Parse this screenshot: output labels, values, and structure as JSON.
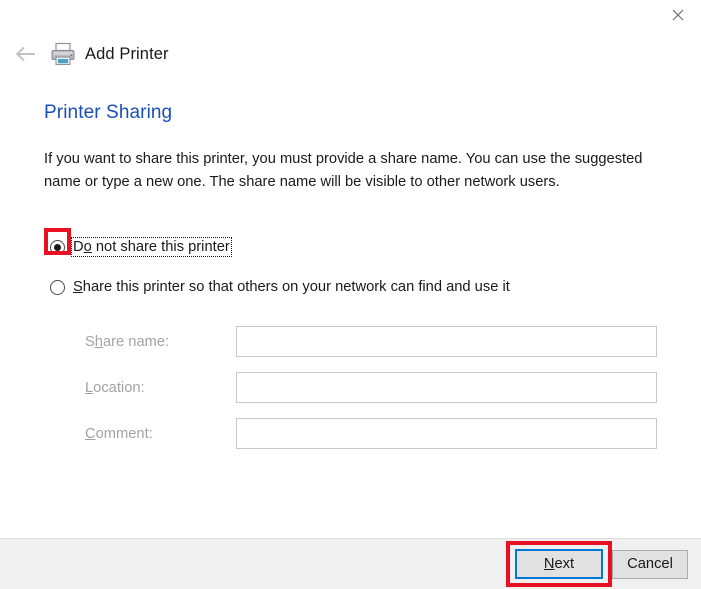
{
  "window": {
    "close_label": "Close",
    "close_icon": "close-icon"
  },
  "nav": {
    "back_icon": "back-arrow-icon",
    "printer_icon": "printer-icon",
    "title": "Add Printer"
  },
  "page": {
    "heading": "Printer Sharing",
    "intro": "If you want to share this printer, you must provide a share name. You can use the suggested name or type a new one. The share name will be visible to other network users."
  },
  "radios": [
    {
      "id": "do-not-share",
      "label_prefix": "D",
      "label_accel": "o",
      "label_suffix": " not share this printer",
      "full_label": "Do not share this printer",
      "checked": true,
      "focused": true,
      "highlighted": true
    },
    {
      "id": "share-printer",
      "label_prefix": "",
      "label_accel": "S",
      "label_suffix": "hare this printer so that others on your network can find and use it",
      "full_label": "Share this printer so that others on your network can find and use it",
      "checked": false,
      "focused": false,
      "highlighted": false
    }
  ],
  "form": {
    "fields": [
      {
        "id": "share-name",
        "label_prefix": "S",
        "label_accel": "h",
        "label_suffix": "are name:",
        "full_label": "Share name:",
        "value": "",
        "placeholder": "",
        "disabled": true
      },
      {
        "id": "location",
        "label_prefix": "",
        "label_accel": "L",
        "label_suffix": "ocation:",
        "full_label": "Location:",
        "value": "",
        "placeholder": "",
        "disabled": true
      },
      {
        "id": "comment",
        "label_prefix": "",
        "label_accel": "C",
        "label_suffix": "omment:",
        "full_label": "Comment:",
        "value": "",
        "placeholder": "",
        "disabled": true
      }
    ]
  },
  "footer": {
    "next_prefix": "",
    "next_accel": "N",
    "next_suffix": "ext",
    "next_label": "Next",
    "cancel_label": "Cancel",
    "next_highlighted": true
  },
  "colors": {
    "heading": "#1a4fbb",
    "highlight": "#e81123",
    "focus_border": "#0078d7",
    "footer_bg": "#f0f0f0",
    "disabled_label": "#a3a3a3",
    "input_border": "#c9c9c9"
  }
}
